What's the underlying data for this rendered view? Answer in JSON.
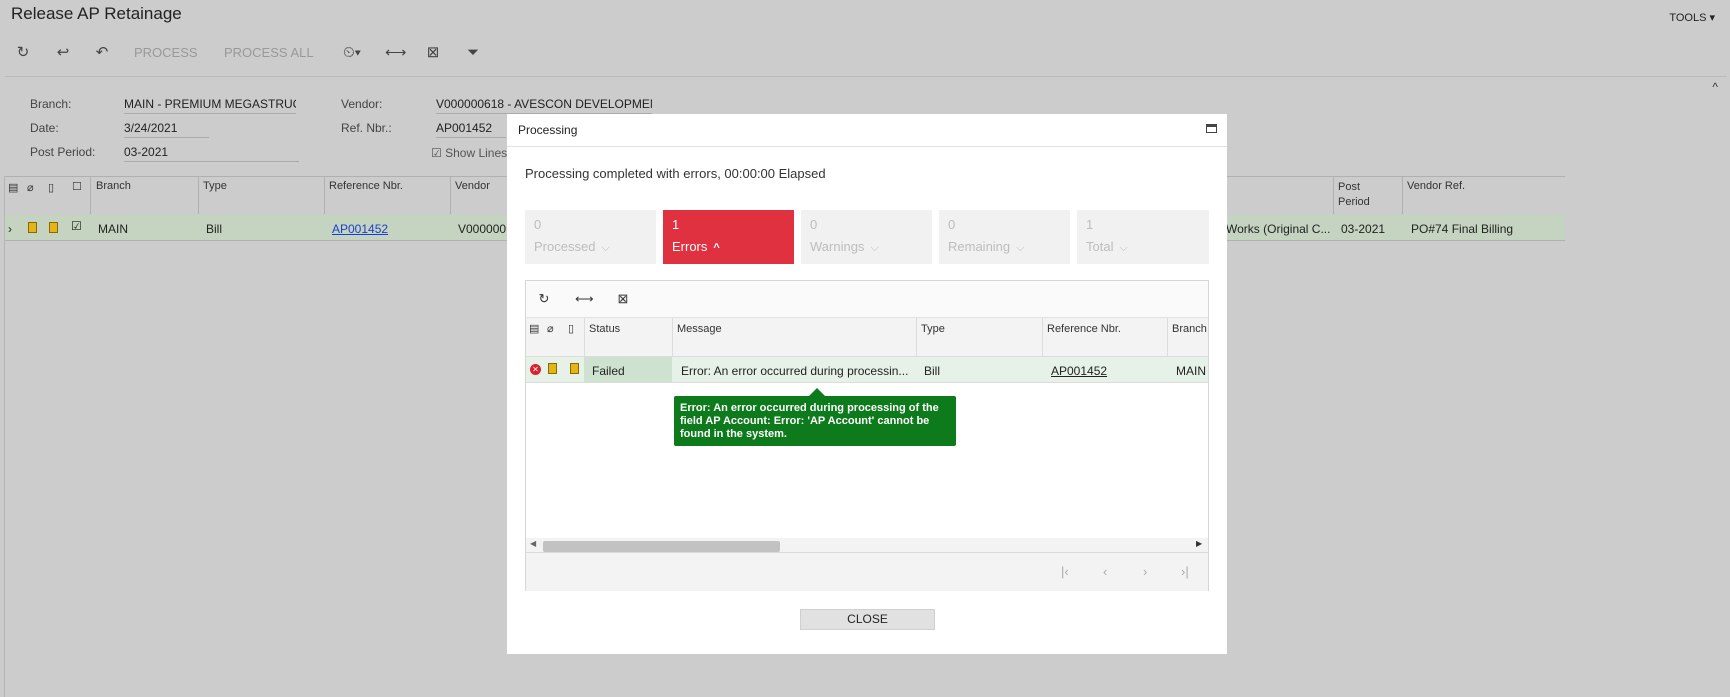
{
  "window": {
    "title": "Release AP Retainage",
    "tools_label": "TOOLS ▾"
  },
  "toolbar": {
    "refresh_icon": "refresh-icon",
    "undo_icon": "undo-icon",
    "redo_icon": "redo-icon",
    "process_label": "PROCESS",
    "process_all_label": "PROCESS ALL"
  },
  "form": {
    "branch_label": "Branch:",
    "branch_value": "MAIN - PREMIUM MEGASTRUC",
    "date_label": "Date:",
    "date_value": "3/24/2021",
    "period_label": "Post Period:",
    "period_value": "03-2021",
    "vendor_label": "Vendor:",
    "vendor_value": "V000000618 - AVESCON DEVELOPMEN",
    "refnbr_label": "Ref. Nbr.:",
    "refnbr_value": "AP001452",
    "show_lines_label": "Show Lines"
  },
  "grid": {
    "headers": {
      "branch": "Branch",
      "type": "Type",
      "ref": "Reference Nbr.",
      "vendor": "Vendor",
      "post_period": "Post Period",
      "vendor_ref": "Vendor Ref."
    },
    "row": {
      "branch": "MAIN",
      "type": "Bill",
      "ref": "AP001452",
      "vendor": "V000000",
      "desc": "Works (Original C...",
      "post_period": "03-2021",
      "vendor_ref": "PO#74 Final Billing"
    }
  },
  "dialog": {
    "title": "Processing",
    "summary": "Processing completed with errors, 00:00:00 Elapsed",
    "stats": {
      "processed": {
        "count": "0",
        "label": "Processed"
      },
      "errors": {
        "count": "1",
        "label": "Errors"
      },
      "warnings": {
        "count": "0",
        "label": "Warnings"
      },
      "remaining": {
        "count": "0",
        "label": "Remaining"
      },
      "total": {
        "count": "1",
        "label": "Total"
      }
    },
    "grid": {
      "headers": {
        "status": "Status",
        "message": "Message",
        "type": "Type",
        "ref": "Reference Nbr.",
        "branch": "Branch"
      },
      "row": {
        "status": "Failed",
        "message": "Error: An error occurred during processin...",
        "type": "Bill",
        "ref": "AP001452",
        "branch": "MAIN"
      }
    },
    "tooltip": "Error: An error occurred during processing of the field AP Account: Error: 'AP Account' cannot be found in the system.",
    "close_label": "CLOSE"
  }
}
